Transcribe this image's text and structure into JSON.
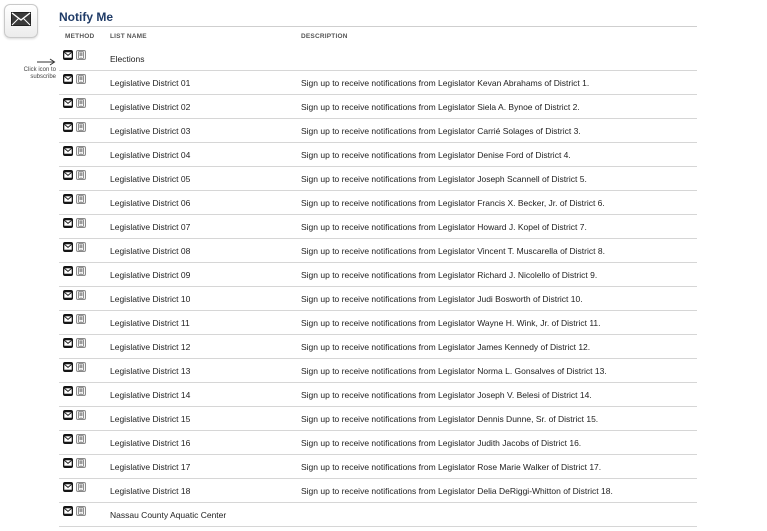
{
  "header": {
    "title": "Notify Me",
    "badge_icon": "envelope-icon"
  },
  "columns": {
    "method": "METHOD",
    "list_name": "LIST NAME",
    "description": "DESCRIPTION"
  },
  "hint": {
    "text": "Click icon to subscribe",
    "arrow_icon": "arrow-right-icon"
  },
  "icons": {
    "email": "email-icon",
    "sms": "phone-icon"
  },
  "rows": [
    {
      "name": "Elections",
      "description": ""
    },
    {
      "name": "Legislative District 01",
      "description": "Sign up to receive notifications from Legislator Kevan Abrahams of District 1."
    },
    {
      "name": "Legislative District 02",
      "description": "Sign up to receive notifications from Legislator Siela A. Bynoe of District 2."
    },
    {
      "name": "Legislative District 03",
      "description": "Sign up to receive notifications from Legislator Carrié Solages of District 3."
    },
    {
      "name": "Legislative District 04",
      "description": "Sign up to receive notifications from Legislator Denise Ford of District 4."
    },
    {
      "name": "Legislative District 05",
      "description": "Sign up to receive notifications from Legislator Joseph Scannell of District 5."
    },
    {
      "name": "Legislative District 06",
      "description": "Sign up to receive notifications from Legislator Francis X. Becker, Jr. of District 6."
    },
    {
      "name": "Legislative District 07",
      "description": "Sign up to receive notifications from Legislator Howard J. Kopel of District 7."
    },
    {
      "name": "Legislative District 08",
      "description": "Sign up to receive notifications from Legislator Vincent T. Muscarella of District 8."
    },
    {
      "name": "Legislative District 09",
      "description": "Sign up to receive notifications from Legislator Richard J. Nicolello of District 9."
    },
    {
      "name": "Legislative District 10",
      "description": "Sign up to receive notifications from Legislator Judi Bosworth of District 10."
    },
    {
      "name": "Legislative District 11",
      "description": "Sign up to receive notifications from Legislator Wayne H. Wink, Jr. of District 11."
    },
    {
      "name": "Legislative District 12",
      "description": "Sign up to receive notifications from Legislator James Kennedy of District 12."
    },
    {
      "name": "Legislative District 13",
      "description": "Sign up to receive notifications from Legislator Norma L. Gonsalves of District 13."
    },
    {
      "name": "Legislative District 14",
      "description": "Sign up to receive notifications from Legislator Joseph V. Belesi of District 14."
    },
    {
      "name": "Legislative District 15",
      "description": "Sign up to receive notifications from Legislator Dennis Dunne, Sr. of District 15."
    },
    {
      "name": "Legislative District 16",
      "description": "Sign up to receive notifications from Legislator Judith Jacobs of District 16."
    },
    {
      "name": "Legislative District 17",
      "description": "Sign up to receive notifications from Legislator Rose Marie Walker of District 17."
    },
    {
      "name": "Legislative District 18",
      "description": "Sign up to receive notifications from Legislator Delia DeRiggi-Whitton of District 18."
    },
    {
      "name": "Nassau County Aquatic Center",
      "description": ""
    }
  ]
}
